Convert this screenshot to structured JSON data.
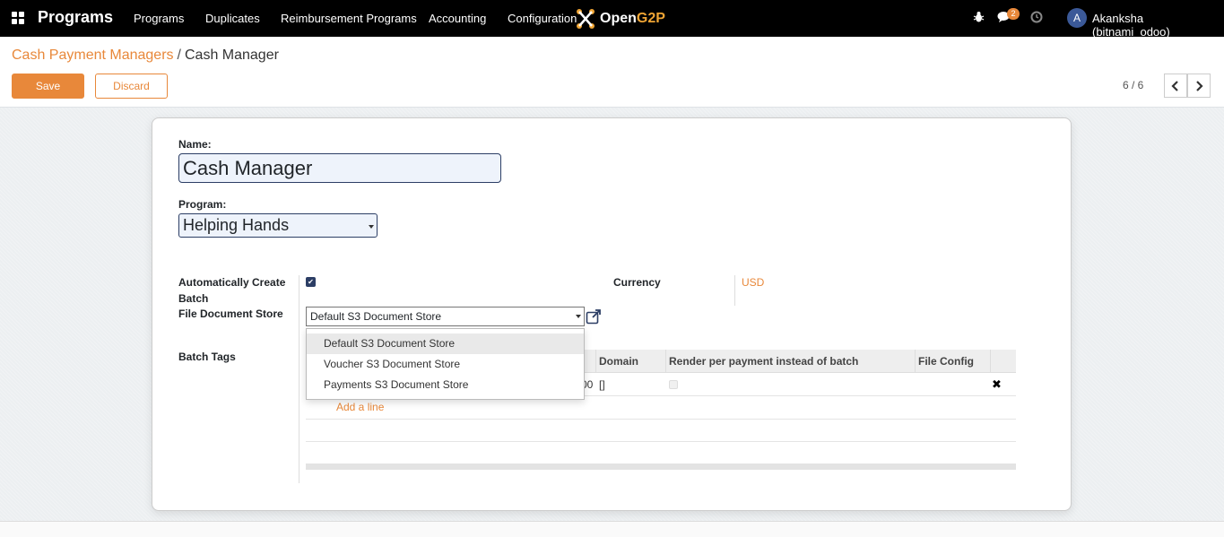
{
  "navbar": {
    "brand": "Programs",
    "menu": [
      "Programs",
      "Duplicates",
      "Reimbursement Programs",
      "Accounting",
      "Configuration"
    ],
    "logo_prefix": "Open",
    "logo_suffix": "G2P",
    "messages_badge": "2",
    "avatar_initial": "A",
    "user": "Akanksha (bitnami_odoo)"
  },
  "breadcrumb": {
    "parent": "Cash Payment Managers",
    "separator": "/",
    "current": "Cash Manager"
  },
  "actions": {
    "save": "Save",
    "discard": "Discard"
  },
  "pager": {
    "value": "6 / 6",
    "prev": "‹",
    "next": "›"
  },
  "form": {
    "name_label": "Name:",
    "name_value": "Cash Manager",
    "program_label": "Program:",
    "program_value": "Helping Hands",
    "auto_batch_label_1": "Automatically Create",
    "auto_batch_label_2": "Batch",
    "auto_batch_checked": true,
    "currency_label": "Currency",
    "currency_value": "USD",
    "file_store_label": "File Document Store",
    "file_store_value": "Default S3 Document Store",
    "batch_tags_label": "Batch Tags"
  },
  "batch_table": {
    "columns": [
      "Domain",
      "Render per payment instead of batch",
      "File Config"
    ],
    "row": {
      "name_tail": "00",
      "domain": "[]",
      "render_per_payment": false
    },
    "add_line": "Add a line"
  },
  "dropdown": {
    "options": [
      "Default S3 Document Store",
      "Voucher S3 Document Store",
      "Payments S3 Document Store"
    ],
    "highlighted": "Default S3 Document Store"
  },
  "colors": {
    "accent": "#e8883a",
    "navbar": "#000000",
    "field_border": "#2c3e65"
  }
}
